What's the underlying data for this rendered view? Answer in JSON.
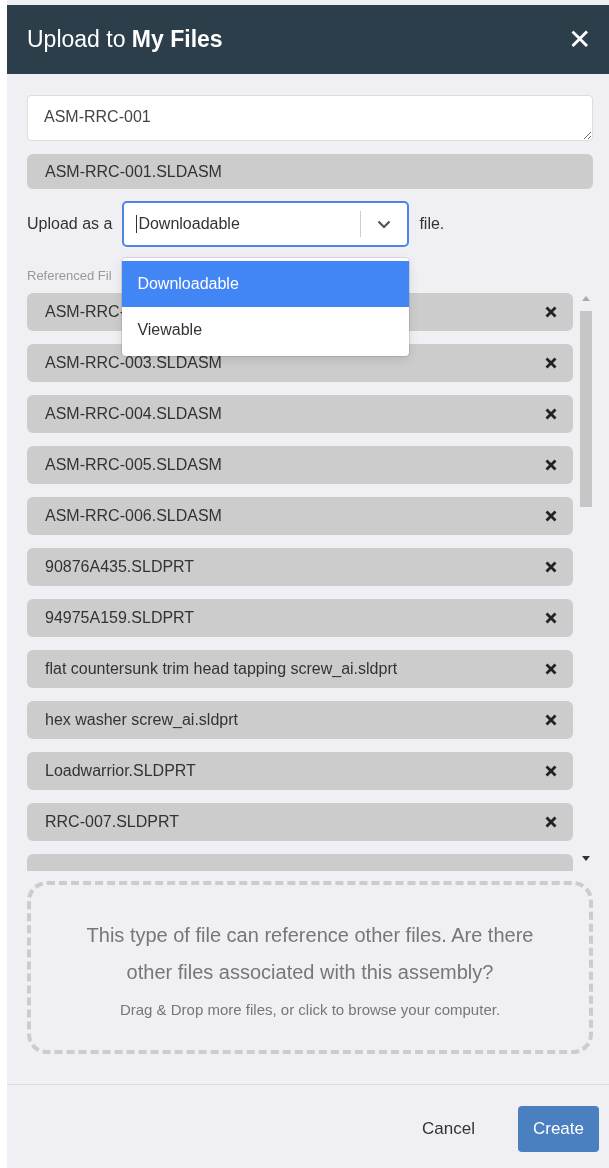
{
  "dialog": {
    "title": "Upload to **My Files**",
    "close": "✕"
  },
  "name_field": {
    "value": "ASM-RRC-001"
  },
  "file_name": "ASM-RRC-001.SLDASM",
  "upload_as": {
    "prefix": "Upload as a",
    "value": "Downloadable",
    "suffix": "file.",
    "expanded": true,
    "options": [
      {
        "label": "Downloadable",
        "selected": true
      },
      {
        "label": "Viewable",
        "selected": false
      }
    ]
  },
  "referenced_files": {
    "label": "Referenced Fil",
    "items": [
      {
        "kind": "file",
        "name": "ASM-RRC-"
      },
      {
        "kind": "file",
        "name": "ASM-RRC-003.SLDASM"
      },
      {
        "kind": "file",
        "name": "ASM-RRC-004.SLDASM"
      },
      {
        "kind": "file",
        "name": "ASM-RRC-005.SLDASM"
      },
      {
        "kind": "file",
        "name": "ASM-RRC-006.SLDASM"
      },
      {
        "kind": "file",
        "name": "90876A435.SLDPRT"
      },
      {
        "kind": "file",
        "name": "94975A159.SLDPRT"
      },
      {
        "kind": "file",
        "name": "flat countersunk trim head tapping screw_ai.sldprt"
      },
      {
        "kind": "file",
        "name": "hex washer screw_ai.sldprt"
      },
      {
        "kind": "file",
        "name": "Loadwarrior.SLDPRT"
      },
      {
        "kind": "file",
        "name": "RRC-007.SLDPRT"
      },
      {
        "kind": "cut"
      }
    ]
  },
  "dropzone": {
    "heading": "This type of file can reference other files. Are there other files associated with this assembly?",
    "hint": "Drag & Drop more files, or click to browse your computer."
  },
  "buttons": [
    {
      "label": "Cancel",
      "kind": "link"
    },
    {
      "label": "Create",
      "kind": "primary"
    }
  ]
}
